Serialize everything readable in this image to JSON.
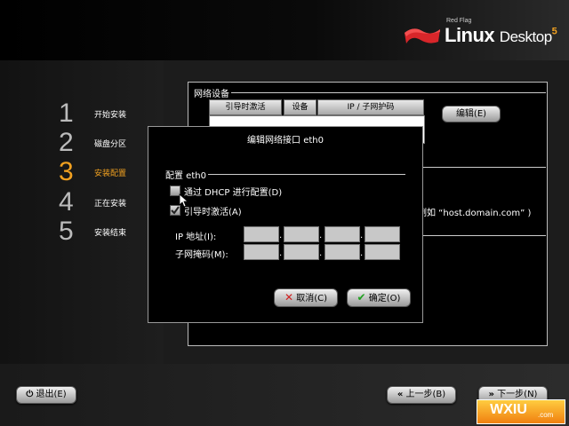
{
  "brand": {
    "small": "Red Flag",
    "linux": "Linux",
    "desktop": "Desktop",
    "version": "5"
  },
  "steps": [
    {
      "num": "1",
      "label": "开始安装"
    },
    {
      "num": "2",
      "label": "磁盘分区"
    },
    {
      "num": "3",
      "label": "安装配置"
    },
    {
      "num": "4",
      "label": "正在安装"
    },
    {
      "num": "5",
      "label": "安装结束"
    }
  ],
  "network": {
    "legend": "网络设备",
    "columns": [
      "引导时激活",
      "设备",
      "IP / 子网护码"
    ],
    "edit_button": "编辑(E)",
    "hostname_example": "例如 “host.domain.com” )"
  },
  "dialog": {
    "title": "编辑网络接口 eth0",
    "config_legend": "配置 eth0",
    "dhcp_label": "通过 DHCP 进行配置(D)",
    "dhcp_checked": false,
    "boot_label": "引导时激活(A)",
    "boot_checked": true,
    "ip_label": "IP 地址(I):",
    "mask_label": "子网掩码(M):",
    "cancel": "取消(C)",
    "ok": "确定(O)"
  },
  "footer": {
    "exit": "退出(E)",
    "back": "上一步(B)",
    "next": "下一步(N)"
  },
  "watermark": {
    "text": "WXIU",
    "domain": ".com"
  },
  "colors": {
    "accent": "#f0a020",
    "background": "#000000"
  }
}
